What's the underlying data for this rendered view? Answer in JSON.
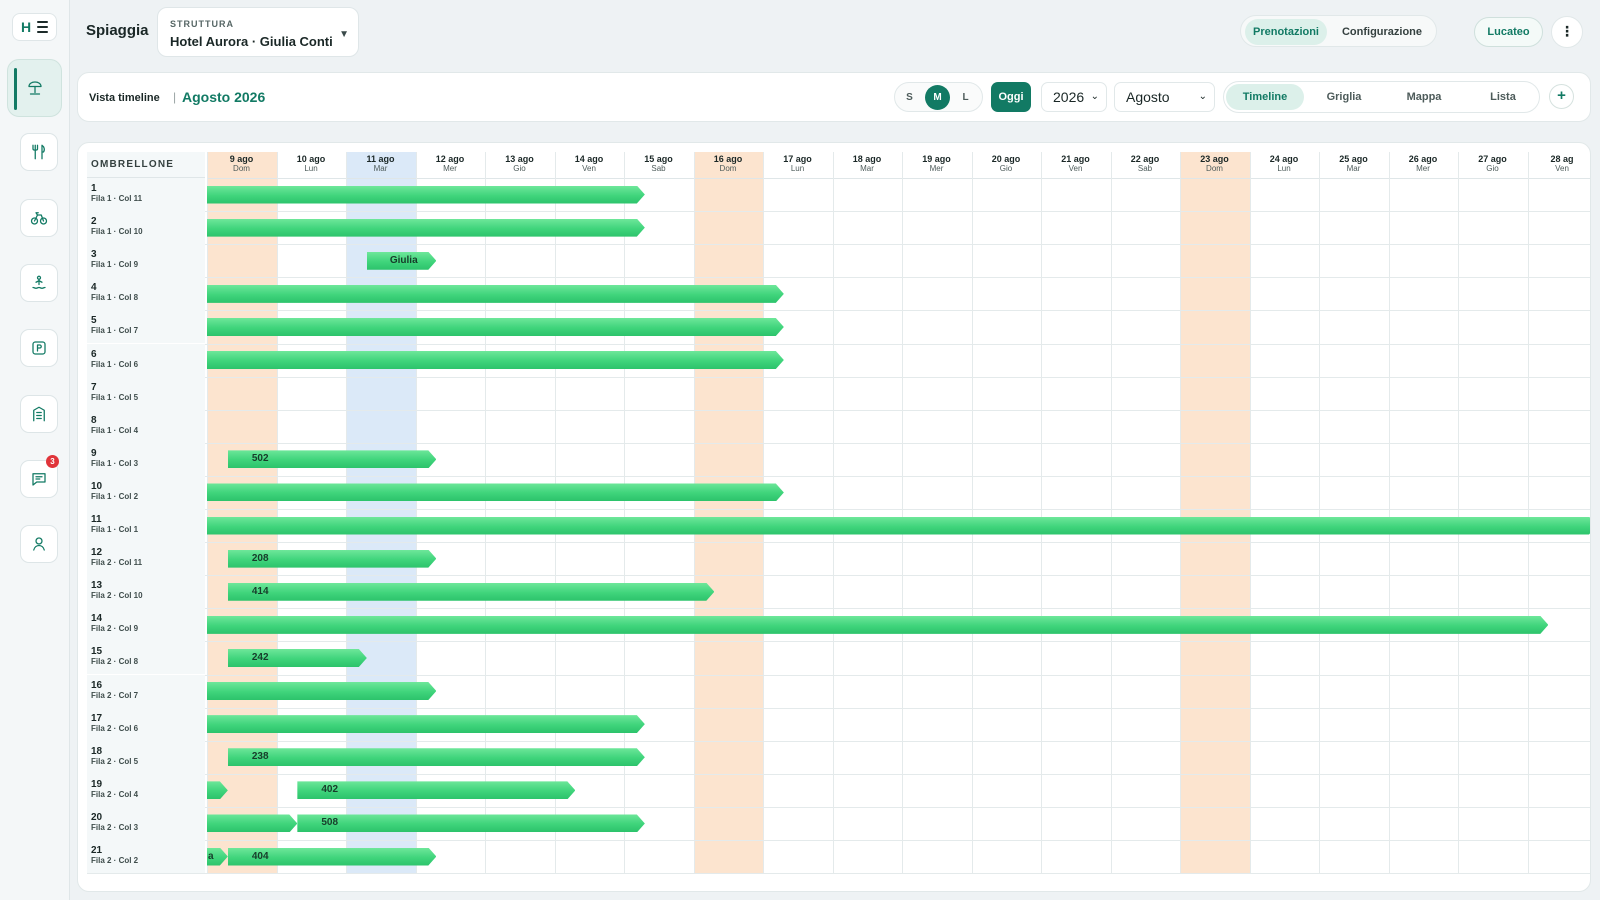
{
  "sidebar": {
    "brand_letter": "H",
    "nav_items": [
      {
        "name": "nav-spiaggia",
        "icon": "umbrella-icon",
        "active": true
      },
      {
        "name": "nav-ristorante",
        "icon": "cutlery-icon"
      },
      {
        "name": "nav-noleggio-bici",
        "icon": "bicycle-icon"
      },
      {
        "name": "nav-attivita",
        "icon": "swimmer-icon"
      },
      {
        "name": "nav-parcheggio",
        "icon": "parking-icon"
      },
      {
        "name": "nav-servizi",
        "icon": "building-icon"
      },
      {
        "name": "nav-messaggi",
        "icon": "chat-icon",
        "badge": "3"
      },
      {
        "name": "nav-profilo",
        "icon": "user-icon"
      }
    ]
  },
  "header": {
    "page_title": "Spiaggia",
    "structure_label": "STRUTTURA",
    "structure_value": "Hotel Aurora · Giulia Conti",
    "tabs": [
      "Prenotazioni",
      "Configurazione"
    ],
    "active_tab": "Prenotazioni",
    "user": "Lucateo",
    "more": "⋮"
  },
  "toolbar": {
    "view_label": "Vista timeline",
    "separator": "|",
    "month_title": "Agosto 2026",
    "sizes": [
      "S",
      "M",
      "L"
    ],
    "active_size": "M",
    "today": "Oggi",
    "year": "2026",
    "month": "Agosto",
    "views": [
      "Timeline",
      "Griglia",
      "Mappa",
      "Lista"
    ],
    "active_view": "Timeline",
    "add": "+"
  },
  "timeline": {
    "row_header": "OMBRELLONE",
    "days": [
      {
        "date": "9 ago",
        "dow": "Dom",
        "shade": "weekend"
      },
      {
        "date": "10 ago",
        "dow": "Lun"
      },
      {
        "date": "11 ago",
        "dow": "Mar",
        "shade": "today"
      },
      {
        "date": "12 ago",
        "dow": "Mer"
      },
      {
        "date": "13 ago",
        "dow": "Gio"
      },
      {
        "date": "14 ago",
        "dow": "Ven"
      },
      {
        "date": "15 ago",
        "dow": "Sab"
      },
      {
        "date": "16 ago",
        "dow": "Dom",
        "shade": "weekend"
      },
      {
        "date": "17 ago",
        "dow": "Lun"
      },
      {
        "date": "18 ago",
        "dow": "Mar"
      },
      {
        "date": "19 ago",
        "dow": "Mer"
      },
      {
        "date": "20 ago",
        "dow": "Gio"
      },
      {
        "date": "21 ago",
        "dow": "Ven"
      },
      {
        "date": "22 ago",
        "dow": "Sab"
      },
      {
        "date": "23 ago",
        "dow": "Dom",
        "shade": "weekend"
      },
      {
        "date": "24 ago",
        "dow": "Lun"
      },
      {
        "date": "25 ago",
        "dow": "Mar"
      },
      {
        "date": "26 ago",
        "dow": "Mer"
      },
      {
        "date": "27 ago",
        "dow": "Gio"
      },
      {
        "date": "28 ag",
        "dow": "Ven"
      }
    ],
    "rows": [
      {
        "num": "1",
        "sub": "Fila 1 · Col 11"
      },
      {
        "num": "2",
        "sub": "Fila 1 · Col 10"
      },
      {
        "num": "3",
        "sub": "Fila 1 · Col 9"
      },
      {
        "num": "4",
        "sub": "Fila 1 · Col 8"
      },
      {
        "num": "5",
        "sub": "Fila 1 · Col 7"
      },
      {
        "num": "6",
        "sub": "Fila 1 · Col 6"
      },
      {
        "num": "7",
        "sub": "Fila 1 · Col 5"
      },
      {
        "num": "8",
        "sub": "Fila 1 · Col 4"
      },
      {
        "num": "9",
        "sub": "Fila 1 · Col 3"
      },
      {
        "num": "10",
        "sub": "Fila 1 · Col 2"
      },
      {
        "num": "11",
        "sub": "Fila 1 · Col 1"
      },
      {
        "num": "12",
        "sub": "Fila 2 · Col 11"
      },
      {
        "num": "13",
        "sub": "Fila 2 · Col 10"
      },
      {
        "num": "14",
        "sub": "Fila 2 · Col 9"
      },
      {
        "num": "15",
        "sub": "Fila 2 · Col 8"
      },
      {
        "num": "16",
        "sub": "Fila 2 · Col 7"
      },
      {
        "num": "17",
        "sub": "Fila 2 · Col 6"
      },
      {
        "num": "18",
        "sub": "Fila 2 · Col 5"
      },
      {
        "num": "19",
        "sub": "Fila 2 · Col 4"
      },
      {
        "num": "20",
        "sub": "Fila 2 · Col 3"
      },
      {
        "num": "21",
        "sub": "Fila 2 · Col 2"
      }
    ],
    "bookings": [
      {
        "row": 0,
        "start": 0,
        "end": 6.3,
        "label": ""
      },
      {
        "row": 1,
        "start": 0,
        "end": 6.3,
        "label": ""
      },
      {
        "row": 2,
        "start": 2.3,
        "end": 3.3,
        "label": "Giulia"
      },
      {
        "row": 3,
        "start": 0,
        "end": 8.3,
        "label": ""
      },
      {
        "row": 4,
        "start": 0,
        "end": 8.3,
        "label": ""
      },
      {
        "row": 5,
        "start": 0,
        "end": 8.3,
        "label": ""
      },
      {
        "row": 8,
        "start": 0.3,
        "end": 3.3,
        "label": "502"
      },
      {
        "row": 9,
        "start": 0,
        "end": 8.3,
        "label": ""
      },
      {
        "row": 10,
        "start": 0,
        "end": 20,
        "label": ""
      },
      {
        "row": 11,
        "start": 0.3,
        "end": 3.3,
        "label": "208"
      },
      {
        "row": 12,
        "start": 0.3,
        "end": 7.3,
        "label": "414"
      },
      {
        "row": 13,
        "start": 0,
        "end": 19.3,
        "label": ""
      },
      {
        "row": 14,
        "start": 0.3,
        "end": 2.3,
        "label": "242"
      },
      {
        "row": 15,
        "start": 0,
        "end": 3.3,
        "label": ""
      },
      {
        "row": 16,
        "start": 0,
        "end": 6.3,
        "label": ""
      },
      {
        "row": 17,
        "start": 0.3,
        "end": 6.3,
        "label": "238"
      },
      {
        "row": 18,
        "start": 0,
        "end": 0.3,
        "label": ""
      },
      {
        "row": 18,
        "start": 1.3,
        "end": 5.3,
        "label": "402"
      },
      {
        "row": 19,
        "start": 0,
        "end": 1.3,
        "label": ""
      },
      {
        "row": 19,
        "start": 1.3,
        "end": 6.3,
        "label": "508"
      },
      {
        "row": 20,
        "start": 0,
        "end": 0.3,
        "label": "a"
      },
      {
        "row": 20,
        "start": 0.3,
        "end": 3.3,
        "label": "404"
      }
    ]
  }
}
